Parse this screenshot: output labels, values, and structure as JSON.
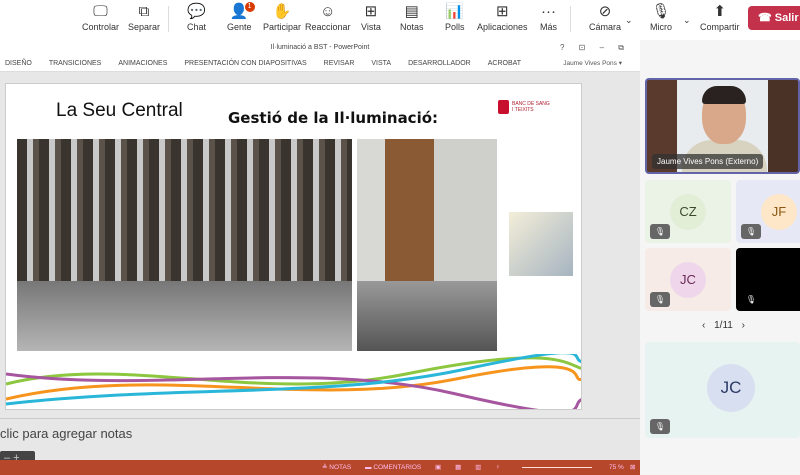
{
  "toolbar": {
    "items": [
      {
        "label": "Controlar",
        "icon": "screen-control-icon"
      },
      {
        "label": "Separar",
        "icon": "popout-icon"
      },
      {
        "label": "Chat",
        "icon": "chat-icon"
      },
      {
        "label": "Gente",
        "icon": "people-icon",
        "badge": "1"
      },
      {
        "label": "Participar",
        "icon": "raise-hand-icon"
      },
      {
        "label": "Reaccionar",
        "icon": "smile-icon"
      },
      {
        "label": "Vista",
        "icon": "grid-icon"
      },
      {
        "label": "Notas",
        "icon": "notes-icon"
      },
      {
        "label": "Polls",
        "icon": "polls-icon"
      },
      {
        "label": "Aplicaciones",
        "icon": "add-icon"
      },
      {
        "label": "Más",
        "icon": "more-icon"
      },
      {
        "label": "Cámara",
        "icon": "camera-off-icon"
      },
      {
        "label": "Micro",
        "icon": "mic-off-icon"
      },
      {
        "label": "Compartir",
        "icon": "share-icon"
      }
    ],
    "leave_label": "Salir",
    "leave_color": "#c4314b"
  },
  "ppt": {
    "window_title": "Il·luminació a BST - PowerPoint",
    "window_buttons": "? ⊡ – ⧉ ✕",
    "tabs": [
      "DISEÑO",
      "TRANSICIONES",
      "ANIMACIONES",
      "PRESENTACIÓN CON DIAPOSITIVAS",
      "REVISAR",
      "VISTA",
      "DESARROLLADOR",
      "ACROBAT"
    ],
    "user": "Jaume Vives Pons ▾",
    "slide": {
      "heading": "La Seu Central",
      "title": "Gestió de la Il·luminació:",
      "logo_text": "BANC DE SANG I TEIXITS"
    },
    "notes_placeholder": "clic para agregar notas",
    "status": {
      "notes": "NOTAS",
      "comments": "COMENTARIOS",
      "zoom": "75 %",
      "color": "#b7472a"
    }
  },
  "meeting": {
    "presenter": "Jaume Vives Pons (Externo)",
    "participants": [
      {
        "initials": "CZ"
      },
      {
        "initials": "JF"
      },
      {
        "initials": "JC"
      },
      {
        "initials": ""
      }
    ],
    "page": "1/11",
    "bottom_participant": "JC"
  }
}
